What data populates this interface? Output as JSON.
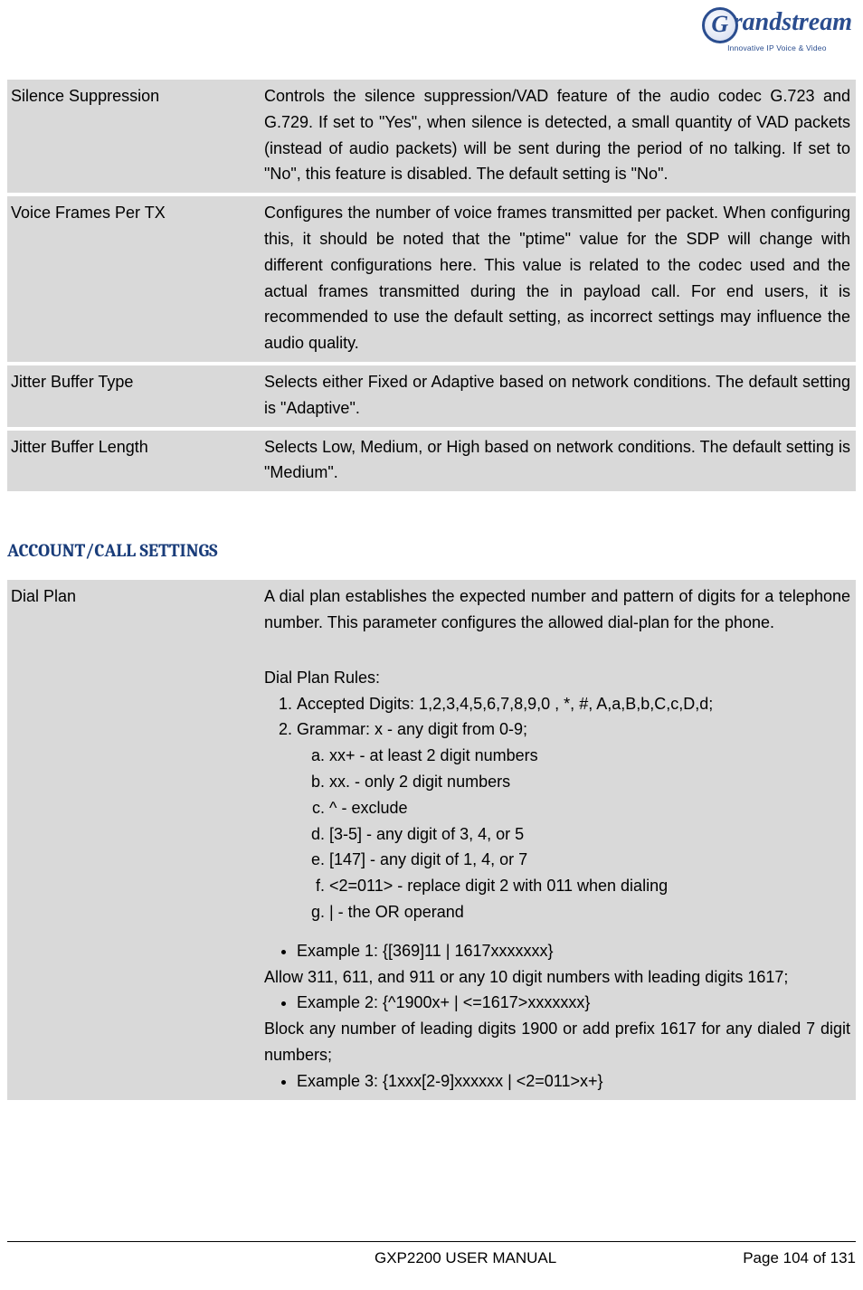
{
  "logo": {
    "brand_initial": "G",
    "brand": "randstream",
    "tagline": "Innovative IP Voice & Video"
  },
  "table1": [
    {
      "label": "Silence Suppression",
      "desc": "Controls the silence suppression/VAD feature of the audio codec G.723 and G.729. If set to \"Yes\", when silence is detected, a small quantity of VAD packets (instead of audio packets) will be sent during the period of no talking. If set to \"No\", this feature is disabled. The default setting is \"No\"."
    },
    {
      "label": "Voice Frames Per TX",
      "desc": "Configures the number of voice frames transmitted per packet. When configuring this, it should be noted that the \"ptime\" value for the SDP will change with different configurations here. This value is related to the codec used and the actual frames transmitted during the in payload call. For end users, it is recommended to use the default setting, as incorrect settings may influence the audio quality."
    },
    {
      "label": "Jitter Buffer Type",
      "desc": "Selects either Fixed or Adaptive based on network conditions. The default setting is \"Adaptive\"."
    },
    {
      "label": "Jitter Buffer Length",
      "desc": "Selects Low, Medium, or High based on network conditions. The default setting is \"Medium\"."
    }
  ],
  "section2_title": "ACCOUNT/CALL SETTINGS",
  "dialplan": {
    "label": "Dial Plan",
    "intro": "A dial plan establishes the expected number and pattern of digits for a telephone number. This parameter configures the allowed dial-plan for the phone.",
    "rules_title": "Dial Plan Rules:",
    "rule1": "Accepted Digits: 1,2,3,4,5,6,7,8,9,0 , *, #, A,a,B,b,C,c,D,d;",
    "rule2": "Grammar: x - any digit from 0-9;",
    "sub_a": "xx+ - at least 2 digit numbers",
    "sub_b": "xx. - only 2 digit numbers",
    "sub_c": "^ - exclude",
    "sub_d": "[3-5] - any digit of 3, 4, or 5",
    "sub_e": "[147] - any digit of 1, 4, or 7",
    "sub_f": "<2=011> - replace digit 2 with 011 when dialing",
    "sub_g": "| - the OR operand",
    "ex1": "Example 1: {[369]11 | 1617xxxxxxx}",
    "ex1_note": "Allow 311, 611, and 911 or any 10 digit numbers with leading digits 1617;",
    "ex2": "Example 2: {^1900x+ | <=1617>xxxxxxx}",
    "ex2_note": "Block any number of leading digits 1900 or add prefix 1617 for any dialed 7 digit numbers;",
    "ex3": "Example 3: {1xxx[2-9]xxxxxx | <2=011>x+}"
  },
  "footer": {
    "manual": "GXP2200 USER MANUAL",
    "page": "Page 104 of 131"
  }
}
